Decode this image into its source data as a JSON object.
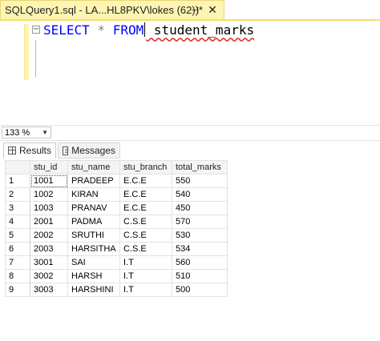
{
  "tab": {
    "title": "SQLQuery1.sql - LA...HL8PKV\\lokes (62))*",
    "pin_glyph": "⊣",
    "close_glyph": "✕"
  },
  "editor": {
    "collapse_glyph": "−",
    "keyword_select": "SELECT",
    "star": " * ",
    "keyword_from": "FROM",
    "table_name": " student_marks"
  },
  "zoom": {
    "value": "133 %"
  },
  "results_tabs": {
    "results_label": "Results",
    "messages_label": "Messages"
  },
  "grid": {
    "columns": [
      "stu_id",
      "stu_name",
      "stu_branch",
      "total_marks"
    ],
    "rows": [
      {
        "n": "1",
        "stu_id": "1001",
        "stu_name": "PRADEEP",
        "stu_branch": "E.C.E",
        "total_marks": "550"
      },
      {
        "n": "2",
        "stu_id": "1002",
        "stu_name": "KIRAN",
        "stu_branch": "E.C.E",
        "total_marks": "540"
      },
      {
        "n": "3",
        "stu_id": "1003",
        "stu_name": "PRANAV",
        "stu_branch": "E.C.E",
        "total_marks": "450"
      },
      {
        "n": "4",
        "stu_id": "2001",
        "stu_name": "PADMA",
        "stu_branch": "C.S.E",
        "total_marks": "570"
      },
      {
        "n": "5",
        "stu_id": "2002",
        "stu_name": "SRUTHI",
        "stu_branch": "C.S.E",
        "total_marks": "530"
      },
      {
        "n": "6",
        "stu_id": "2003",
        "stu_name": "HARSITHA",
        "stu_branch": "C.S.E",
        "total_marks": "534"
      },
      {
        "n": "7",
        "stu_id": "3001",
        "stu_name": "SAI",
        "stu_branch": "I.T",
        "total_marks": "560"
      },
      {
        "n": "8",
        "stu_id": "3002",
        "stu_name": "HARSH",
        "stu_branch": "I.T",
        "total_marks": "510"
      },
      {
        "n": "9",
        "stu_id": "3003",
        "stu_name": "HARSHINI",
        "stu_branch": "I.T",
        "total_marks": "500"
      }
    ]
  },
  "colors": {
    "keyword": "#0000ff",
    "operator": "#808080",
    "tab_active": "#fff5b3",
    "squiggle": "#e03030"
  }
}
